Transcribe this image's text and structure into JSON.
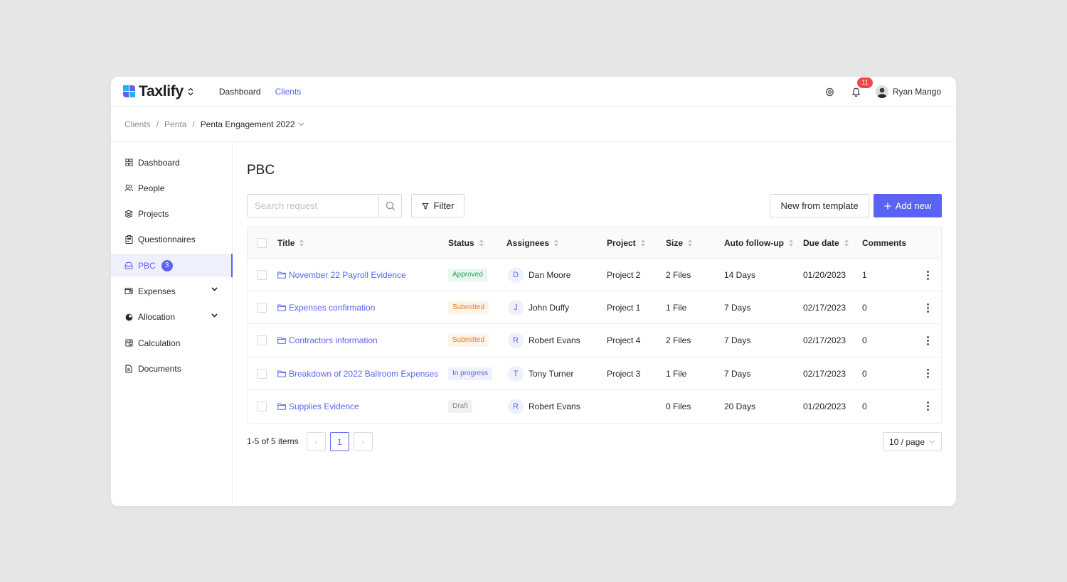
{
  "app": {
    "logo_text": "Taxlify",
    "nav": [
      {
        "label": "Dashboard",
        "active": false
      },
      {
        "label": "Clients",
        "active": true
      }
    ],
    "notifications_count": "11",
    "user_name": "Ryan Mango",
    "accent_color": "#5b63f5"
  },
  "breadcrumb": {
    "items": [
      "Clients",
      "Penta"
    ],
    "current": "Penta Engagement 2022",
    "separator": "/"
  },
  "sidebar": {
    "items": [
      {
        "label": "Dashboard",
        "icon": "grid-icon"
      },
      {
        "label": "People",
        "icon": "people-icon"
      },
      {
        "label": "Projects",
        "icon": "layers-icon"
      },
      {
        "label": "Questionnaires",
        "icon": "clipboard-icon"
      },
      {
        "label": "PBC",
        "icon": "inbox-icon",
        "active": true,
        "badge": "3"
      },
      {
        "label": "Expenses",
        "icon": "wallet-icon",
        "expandable": true
      },
      {
        "label": "Allocation",
        "icon": "pie-icon",
        "expandable": true
      },
      {
        "label": "Calculation",
        "icon": "calculator-icon"
      },
      {
        "label": "Documents",
        "icon": "document-icon"
      }
    ]
  },
  "main": {
    "title": "PBC",
    "search_placeholder": "Search request",
    "filter_label": "Filter",
    "new_from_template_label": "New from template",
    "add_new_label": "Add new"
  },
  "table": {
    "columns": [
      "Title",
      "Status",
      "Assignees",
      "Project",
      "Size",
      "Auto follow-up",
      "Due date",
      "Comments"
    ],
    "rows": [
      {
        "title": "November 22 Payroll Evidence",
        "status": "Approved",
        "status_kind": "approved",
        "initial": "D",
        "assignee": "Dan Moore",
        "project": "Project 2",
        "size": "2 Files",
        "followup": "14 Days",
        "due": "01/20/2023",
        "comments": "1"
      },
      {
        "title": "Expenses confirmation",
        "status": "Submitted",
        "status_kind": "submitted",
        "initial": "J",
        "assignee": "John Duffy",
        "project": "Project 1",
        "size": "1 File",
        "followup": "7 Days",
        "due": "02/17/2023",
        "comments": "0"
      },
      {
        "title": "Contractors information",
        "status": "Submitted",
        "status_kind": "submitted",
        "initial": "R",
        "assignee": "Robert Evans",
        "project": "Project 4",
        "size": "2 Files",
        "followup": "7 Days",
        "due": "02/17/2023",
        "comments": "0"
      },
      {
        "title": "Breakdown of 2022 Ballroom Expenses",
        "status": "In progress",
        "status_kind": "progress",
        "initial": "T",
        "assignee": "Tony Turner",
        "project": "Project 3",
        "size": "1 File",
        "followup": "7 Days",
        "due": "02/17/2023",
        "comments": "0"
      },
      {
        "title": "Supplies Evidence",
        "status": "Draft",
        "status_kind": "draft",
        "initial": "R",
        "assignee": "Robert Evans",
        "project": "",
        "size": "0 Files",
        "followup": "20 Days",
        "due": "01/20/2023",
        "comments": "0"
      }
    ]
  },
  "pagination": {
    "total_text": "1-5 of 5 items",
    "current_page": "1",
    "prev_symbol": "‹",
    "next_symbol": "›",
    "page_size": "10 / page"
  }
}
